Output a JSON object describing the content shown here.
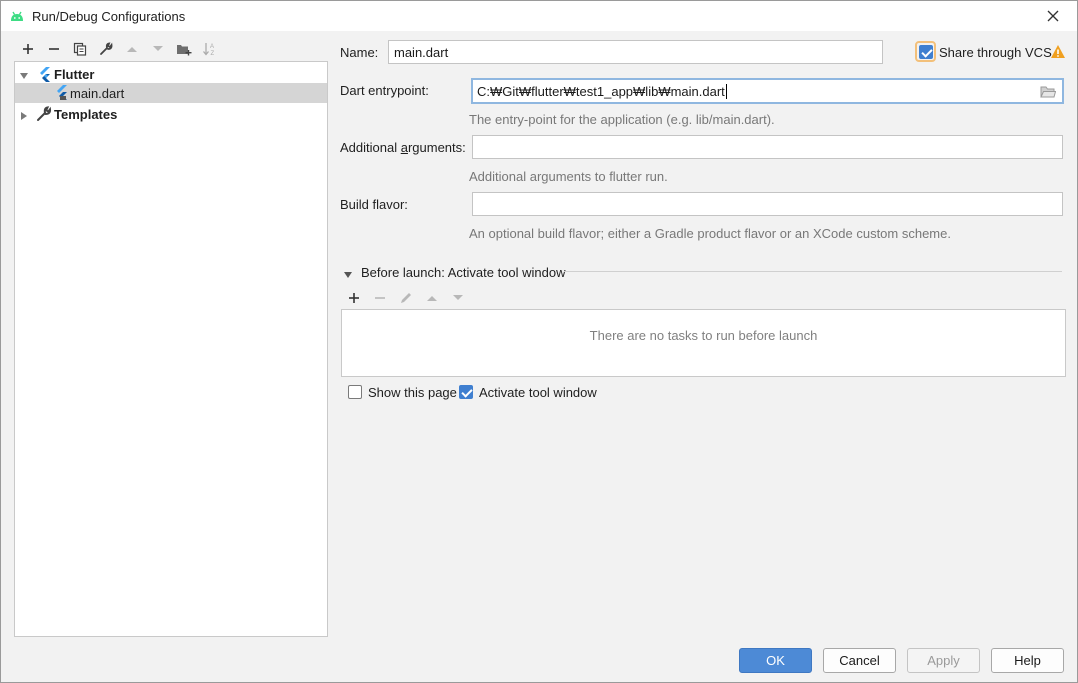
{
  "window": {
    "title": "Run/Debug Configurations",
    "app_icon": "android-icon",
    "close_icon": "close-icon"
  },
  "left_toolbar": {
    "icons": [
      "add-icon",
      "remove-icon",
      "copy-icon",
      "wrench-icon",
      "move-up-icon",
      "move-down-icon",
      "new-folder-icon",
      "sort-icon"
    ]
  },
  "tree": {
    "items": [
      {
        "label": "Flutter",
        "icon": "flutter-icon",
        "expanded": true
      },
      {
        "label": "main.dart",
        "icon": "flutter-config-icon",
        "selected": true
      },
      {
        "label": "Templates",
        "icon": "wrench-icon",
        "expanded": false
      }
    ]
  },
  "form": {
    "name_label": "Name:",
    "name_value": "main.dart",
    "share_vcs_label": "Share through VCS",
    "share_vcs_checked": true,
    "warning_icon": "warning-icon",
    "entrypoint_label": "Dart entrypoint:",
    "entrypoint_value": "C:₩Git₩flutter₩test1_app₩lib₩main.dart",
    "entrypoint_hint": "The entry-point for the application (e.g. lib/main.dart).",
    "args_label": "Additional arguments:",
    "args_value": "",
    "args_hint": "Additional arguments to flutter run.",
    "flavor_label": "Build flavor:",
    "flavor_value": "",
    "flavor_hint": "An optional build flavor; either a Gradle product flavor or an XCode custom scheme."
  },
  "before_launch": {
    "title": "Before launch: Activate tool window",
    "toolbar_icons": [
      "add-icon",
      "remove-icon",
      "edit-icon",
      "move-up-icon",
      "move-down-icon"
    ],
    "empty_text": "There are no tasks to run before launch",
    "show_page_label": "Show this page",
    "show_page_checked": false,
    "activate_label": "Activate tool window",
    "activate_checked": true
  },
  "buttons": {
    "ok": "OK",
    "cancel": "Cancel",
    "apply": "Apply",
    "help": "Help"
  },
  "colors": {
    "accent": "#4d8ad6",
    "focus_ring": "#8fb7e0",
    "warning": "#f0a020",
    "flutter_blue": "#42a5f5"
  }
}
